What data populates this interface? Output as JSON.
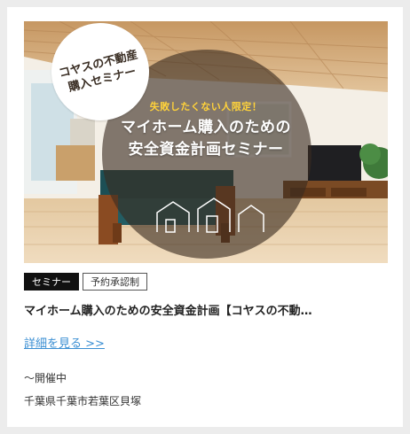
{
  "card": {
    "image": {
      "badge_line1": "コヤスの不動産",
      "badge_line2": "購入セミナー",
      "subtitle": "失敗したくない人限定！",
      "title_line1": "マイホーム購入のための",
      "title_line2": "安全資金計画セミナー"
    },
    "tags": [
      "セミナー",
      "予約承認制"
    ],
    "title": "マイホーム購入のための安全資金計画【コヤスの不動…",
    "detail_link": "詳細を見る >>",
    "status": "〜開催中",
    "location": "千葉県千葉市若葉区貝塚"
  }
}
